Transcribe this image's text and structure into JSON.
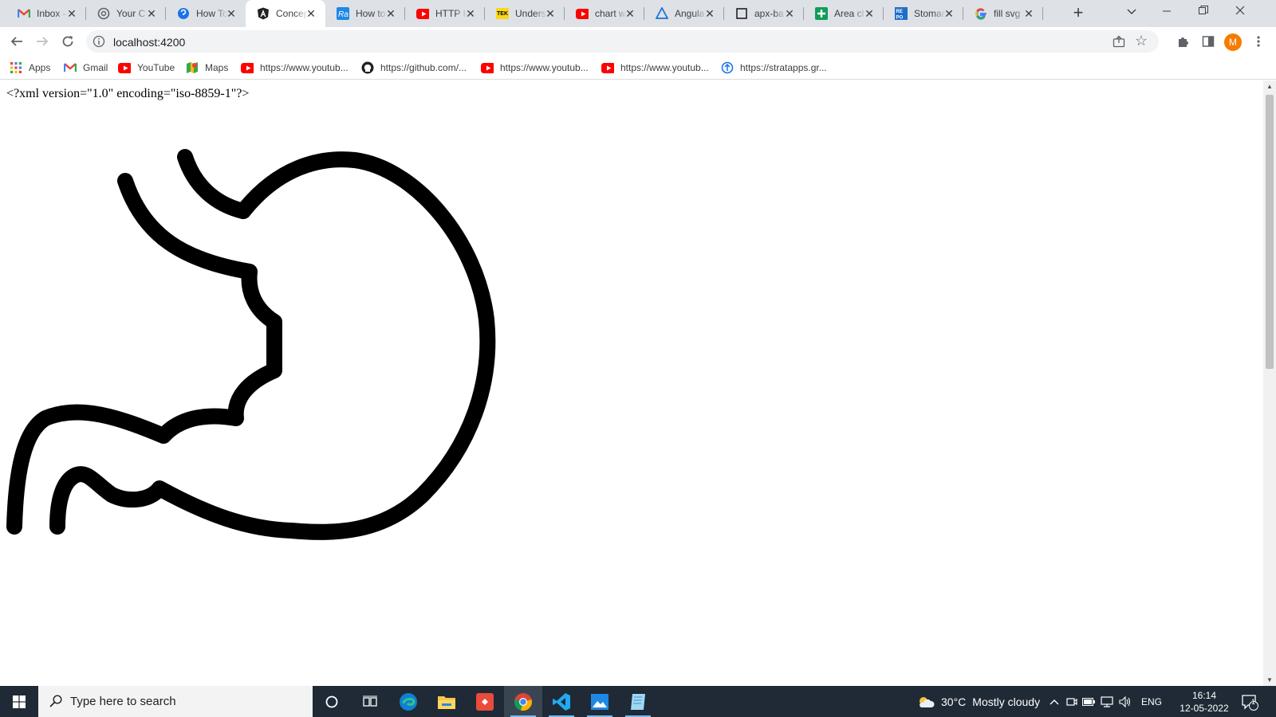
{
  "tabs": [
    {
      "title": "Inbox - ",
      "icon": "gmail-icon"
    },
    {
      "title": "Your C",
      "icon": "openai-icon"
    },
    {
      "title": "How To",
      "icon": "help-icon"
    },
    {
      "title": "Concep",
      "icon": "angular-icon"
    },
    {
      "title": "How to",
      "icon": "react-icon"
    },
    {
      "title": "HTTP Ir",
      "icon": "youtube-icon"
    },
    {
      "title": "Unders",
      "icon": "tek-icon"
    },
    {
      "title": "chart w",
      "icon": "youtube-icon"
    },
    {
      "title": "Angula",
      "icon": "angular-material-icon"
    },
    {
      "title": "apx-ba",
      "icon": "square-icon"
    },
    {
      "title": "Area cl",
      "icon": "plus-square-icon"
    },
    {
      "title": "Stomac",
      "icon": "repo-icon"
    },
    {
      "title": "fill svg",
      "icon": "google-icon"
    }
  ],
  "active_tab_index": 3,
  "address": {
    "url": "localhost:4200"
  },
  "bookmarks": [
    {
      "label": "Apps",
      "icon": "apps-grid-icon"
    },
    {
      "label": "Gmail",
      "icon": "gmail-icon"
    },
    {
      "label": "YouTube",
      "icon": "youtube-icon"
    },
    {
      "label": "Maps",
      "icon": "maps-icon"
    },
    {
      "label": "https://www.youtub...",
      "icon": "youtube-icon"
    },
    {
      "label": "https://github.com/...",
      "icon": "github-icon"
    },
    {
      "label": "https://www.youtub...",
      "icon": "youtube-icon"
    },
    {
      "label": "https://www.youtub...",
      "icon": "youtube-icon"
    },
    {
      "label": "https://stratapps.gr...",
      "icon": "stratapps-icon"
    }
  ],
  "profile": {
    "initial": "M",
    "color": "#f57c00"
  },
  "page": {
    "xml_declaration": "<?xml version=\"1.0\" encoding=\"iso-8859-1\"?>"
  },
  "taskbar": {
    "search_placeholder": "Type here to search",
    "weather": {
      "temp": "30°C",
      "condition": "Mostly cloudy"
    },
    "language": "ENG",
    "time": "16:14",
    "date": "12-05-2022",
    "notification_count": "1"
  }
}
